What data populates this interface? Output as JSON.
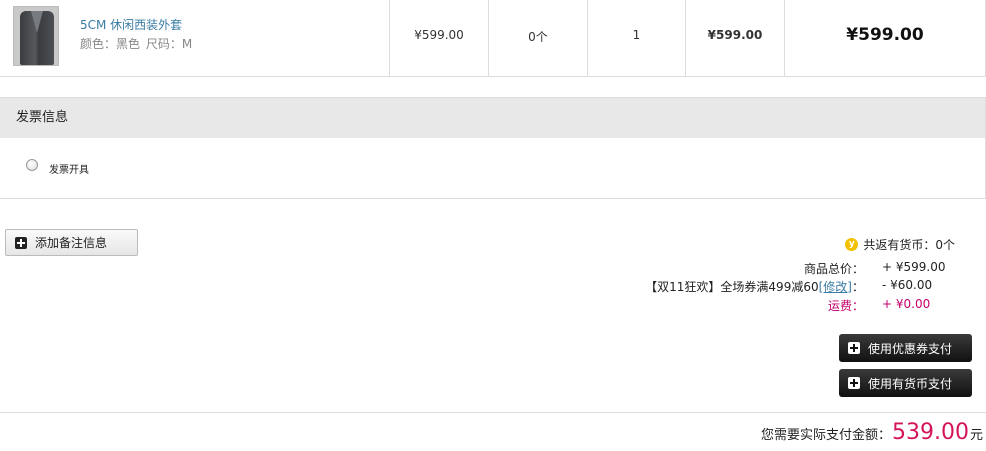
{
  "product": {
    "name": "5CM 休闲西装外套",
    "color_label": "颜色：黑色",
    "size_label": "尺码：M",
    "unit_price": "¥599.00",
    "coins": "0个",
    "quantity": "1",
    "subtotal": "¥599.00",
    "total": "¥599.00"
  },
  "invoice": {
    "title": "发票信息",
    "option_label": "发票开具"
  },
  "remark_button": "添加备注信息",
  "summary": {
    "coin_icon": "y",
    "coin_return": "共返有货币：0个",
    "goods_total_label": "商品总价：",
    "goods_total_value": "+ ¥599.00",
    "promo_label_prefix": "【双11狂欢】全场券满499减60",
    "promo_edit_link": "[修改]",
    "promo_label_suffix": "：",
    "promo_value": "- ¥60.00",
    "shipping_label": "运费：",
    "shipping_value": "+ ¥0.00"
  },
  "buttons": {
    "coupon_pay": "使用优惠券支付",
    "coin_pay": "使用有货币支付"
  },
  "payment": {
    "prefix": "您需要实际支付金额：",
    "amount": "539.00",
    "unit": "元"
  },
  "colors": {
    "link": "#3a7ca5",
    "price_red": "#d4145a",
    "shipping_magenta": "#c3006b",
    "header_gray": "#e8e8e8",
    "coin_yellow": "#f2c200"
  }
}
